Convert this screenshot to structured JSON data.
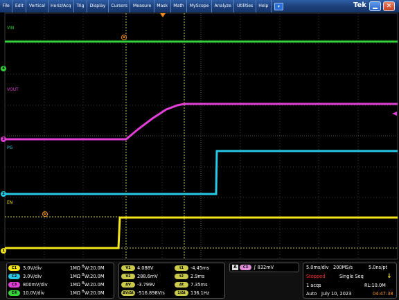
{
  "menu": [
    "File",
    "Edit",
    "Vertical",
    "Horiz/Acq",
    "Trig",
    "Display",
    "Cursors",
    "Measure",
    "Mask",
    "Math",
    "MyScope",
    "Analyze",
    "Utilities",
    "Help"
  ],
  "brand": "Tek",
  "waveform_labels": {
    "vin": "VIN",
    "vout": "VOUT",
    "pg": "PG",
    "en": "EN"
  },
  "channel_markers": {
    "ch1": "1",
    "ch2": "2",
    "ch3": "3",
    "ch4": "4"
  },
  "cursor_markers": {
    "a": "a",
    "b": "b"
  },
  "channels": [
    {
      "badge": "C1",
      "scale": "3.0V/div",
      "impedance": "1MΩ",
      "bw": "B",
      "bw_value": "W:20.0M",
      "color": "#f5e61a"
    },
    {
      "badge": "C2",
      "scale": "3.0V/div",
      "impedance": "1MΩ",
      "bw": "B",
      "bw_value": "W:20.0M",
      "color": "#27c9e6"
    },
    {
      "badge": "C3",
      "scale": "800mV/div",
      "impedance": "1MΩ",
      "bw": "B",
      "bw_value": "W:20.0M",
      "color": "#e33fd8"
    },
    {
      "badge": "C4",
      "scale": "10.0V/div",
      "impedance": "1MΩ",
      "bw": "B",
      "bw_value": "W:20.0M",
      "color": "#35d43a"
    }
  ],
  "cursors": {
    "v1_label": "V1",
    "v1": "4.088V",
    "v2_label": "V2",
    "v2": "288.6mV",
    "dv_label": "ΔV",
    "dv": "-3.799V",
    "dvdt_label": "ΔV/Δt",
    "dvdt": "-516.898V/s",
    "t1_label": "t1",
    "t1": "-4.45ms",
    "t2_label": "t2",
    "t2": "2.9ms",
    "dt_label": "Δt",
    "dt": "7.35ms",
    "inv_dt_label": "1/Δt",
    "inv_dt": "136.1Hz"
  },
  "trigger": {
    "mode": "A",
    "source": "C3",
    "slope": "∫",
    "level": "832mV"
  },
  "acquisition": {
    "timebase": "5.0ms/div",
    "sample_rate": "200MS/s",
    "resolution": "5.0ns/pt",
    "state": "Stopped",
    "sequence": "Single Seq",
    "acqs": "1 acqs",
    "record_length": "RL:10.0M",
    "trigger_mode": "Auto",
    "date": "July 10, 2023",
    "time": "04:47:38"
  },
  "colors": {
    "ch1": "#f5e61a",
    "ch2": "#27c9e6",
    "ch3": "#e33fd8",
    "ch4": "#35d43a",
    "cursor": "#c9c94a",
    "stopped": "#ff3b3b",
    "time": "#ff9c2a"
  }
}
